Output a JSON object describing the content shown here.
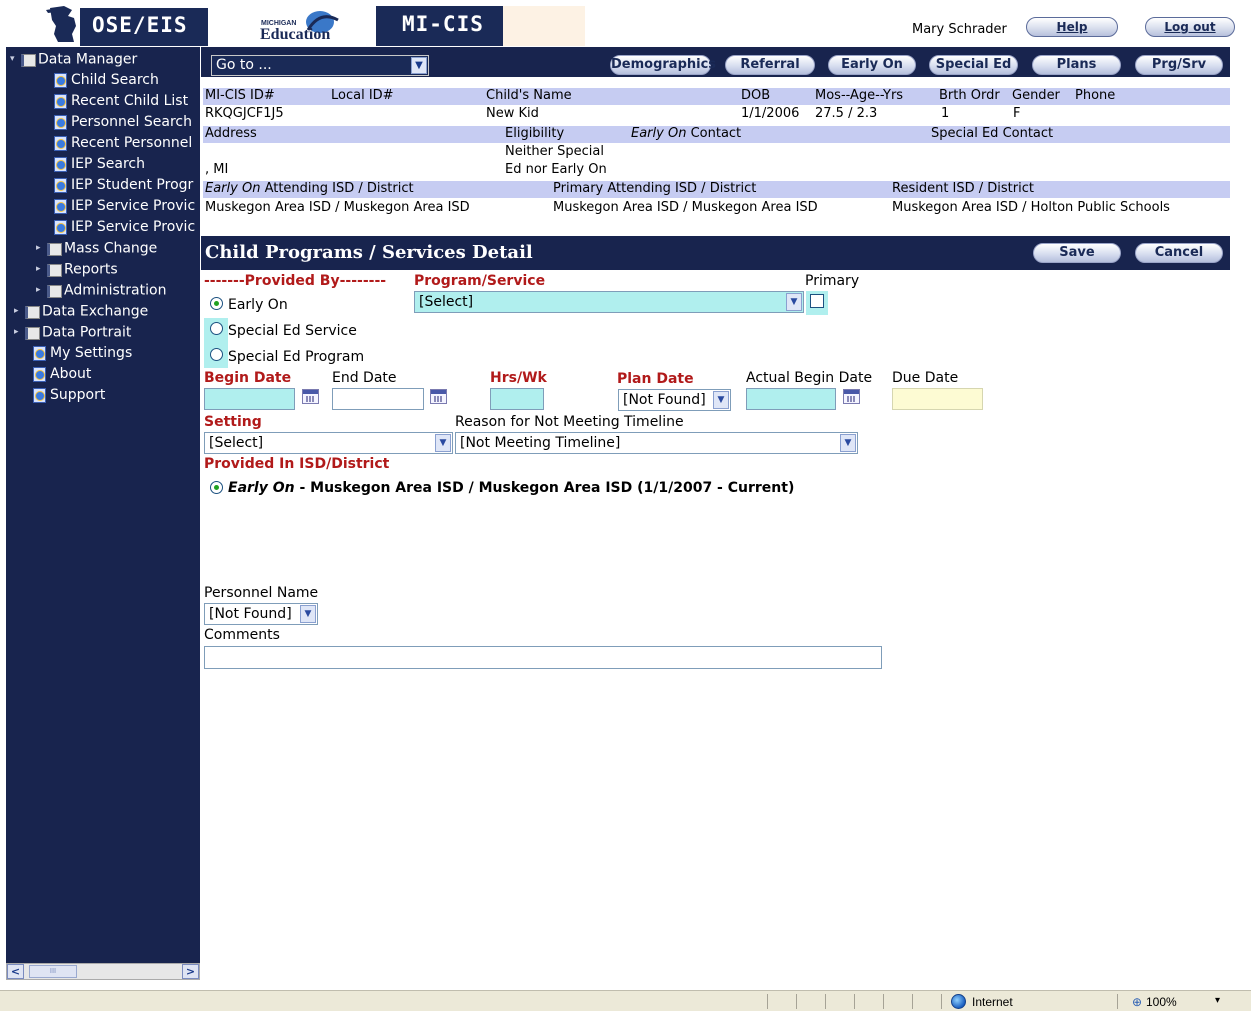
{
  "header": {
    "brand": "OSE/EIS",
    "edu_small": "MICHIGAN",
    "edu_big": "Education",
    "app_name": "MI-CIS",
    "user_name": "Mary Schrader",
    "help_label": "Help",
    "logout_label": "Log out"
  },
  "sidebar": {
    "items": [
      {
        "label": "Data Manager",
        "icon": "book-icon",
        "expander": "▾"
      },
      {
        "label": "Child Search",
        "icon": "page-icon"
      },
      {
        "label": "Recent Child List",
        "icon": "page-icon"
      },
      {
        "label": "Personnel Search",
        "icon": "page-icon"
      },
      {
        "label": "Recent Personnel",
        "icon": "page-icon"
      },
      {
        "label": "IEP Search",
        "icon": "page-icon"
      },
      {
        "label": "IEP Student Progr",
        "icon": "page-icon"
      },
      {
        "label": "IEP Service Provic",
        "icon": "page-icon"
      },
      {
        "label": "IEP Service Provic",
        "icon": "page-icon"
      },
      {
        "label": "Mass Change",
        "icon": "book-icon",
        "expander": "▸"
      },
      {
        "label": "Reports",
        "icon": "book-icon",
        "expander": "▸"
      },
      {
        "label": "Administration",
        "icon": "book-icon",
        "expander": "▸"
      },
      {
        "label": "Data Exchange",
        "icon": "book-icon",
        "expander": "▸"
      },
      {
        "label": "Data Portrait",
        "icon": "book-icon",
        "expander": "▸"
      },
      {
        "label": "My Settings",
        "icon": "page-icon"
      },
      {
        "label": "About",
        "icon": "page-icon"
      },
      {
        "label": "Support",
        "icon": "page-icon"
      }
    ],
    "scroll_left": "<",
    "scroll_right": ">",
    "scroll_thumb": "III"
  },
  "toolbar": {
    "goto_value": "Go to ...",
    "buttons": [
      "Demographics",
      "Referral",
      "Early On",
      "Special Ed",
      "Plans",
      "Prg/Srv"
    ]
  },
  "child": {
    "headers": {
      "micis_id": "MI-CIS ID#",
      "local_id": "Local ID#",
      "name": "Child's Name",
      "dob": "DOB",
      "age": "Mos--Age--Yrs",
      "birth_order": "Brth Ordr",
      "gender": "Gender",
      "phone": "Phone"
    },
    "values": {
      "micis_id": "RKQGJCF1J5",
      "local_id": "",
      "name": "New Kid",
      "dob": "1/1/2006",
      "age": "27.5 / 2.3",
      "birth_order": "1",
      "gender": "F",
      "phone": ""
    },
    "address_label": "Address",
    "eligibility_label": "Eligibility",
    "early_on_italic": "Early On",
    "contact_label": "Contact",
    "special_ed_contact_label": "Special Ed Contact",
    "address_value": ", MI",
    "eligibility_value_1": "Neither Special",
    "eligibility_value_2": "Ed nor Early On",
    "attending_italic": "Early On",
    "attending_label": "Attending ISD / District",
    "primary_attending_label": "Primary Attending ISD / District",
    "resident_label": "Resident ISD / District",
    "attending_value": "Muskegon Area ISD / Muskegon Area ISD",
    "primary_attending_value": "Muskegon Area ISD / Muskegon Area ISD",
    "resident_value": "Muskegon Area ISD / Holton Public Schools"
  },
  "detail": {
    "title": "Child Programs / Services Detail",
    "save_label": "Save",
    "cancel_label": "Cancel",
    "provided_by_label": "-------Provided By--------",
    "program_service_label": "Program/Service",
    "primary_label": "Primary",
    "program_value": "[Select]",
    "radio_early_on": "Early On",
    "radio_special_ed_service": "Special Ed Service",
    "radio_special_ed_program": "Special Ed Program",
    "begin_date_label": "Begin Date",
    "end_date_label": "End Date",
    "hrs_wk_label": "Hrs/Wk",
    "plan_date_label": "Plan Date",
    "actual_begin_label": "Actual Begin Date",
    "due_date_label": "Due Date",
    "plan_date_value": "[Not Found]",
    "setting_label": "Setting",
    "setting_value": "[Select]",
    "reason_label": "Reason for Not Meeting Timeline",
    "reason_value": "[Not Meeting Timeline]",
    "provided_in_label": "Provided In ISD/District",
    "provided_in_italic": "Early On",
    "provided_in_value": " - Muskegon Area ISD / Muskegon Area ISD (1/1/2007 - Current)",
    "personnel_label": "Personnel Name",
    "personnel_value": "[Not Found]",
    "comments_label": "Comments"
  },
  "statusbar": {
    "zone": "Internet",
    "zoom": "100%",
    "zoom_arrow": "▾"
  },
  "colors": {
    "navy": "#18244e",
    "lavender": "#c6ccf2",
    "required_red": "#b11a1a",
    "field_cyan": "#b0efee",
    "field_yellow": "#fdfbd3"
  }
}
